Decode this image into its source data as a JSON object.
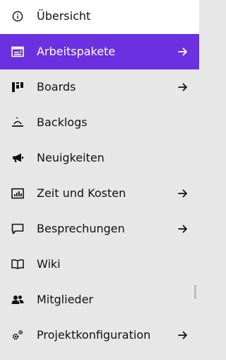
{
  "colors": {
    "active_background": "#6b31e0",
    "active_text": "#ffffff",
    "sidebar_background": "#e7e7e7",
    "top_item_background": "#ffffff",
    "text": "#111111"
  },
  "menu": {
    "items": [
      {
        "label": "Übersicht",
        "icon": "info-icon",
        "arrow": false
      },
      {
        "label": "Arbeitspakete",
        "icon": "work-packages-icon",
        "arrow": true,
        "active": true
      },
      {
        "label": "Boards",
        "icon": "boards-icon",
        "arrow": true
      },
      {
        "label": "Backlogs",
        "icon": "backlogs-icon",
        "arrow": false
      },
      {
        "label": "Neuigkeiten",
        "icon": "megaphone-icon",
        "arrow": false
      },
      {
        "label": "Zeit und Kosten",
        "icon": "time-costs-icon",
        "arrow": true
      },
      {
        "label": "Besprechungen",
        "icon": "speech-bubble-icon",
        "arrow": true
      },
      {
        "label": "Wiki",
        "icon": "book-icon",
        "arrow": false
      },
      {
        "label": "Mitglieder",
        "icon": "members-icon",
        "arrow": false
      },
      {
        "label": "Projektkonfiguration",
        "icon": "gears-icon",
        "arrow": true
      }
    ]
  }
}
